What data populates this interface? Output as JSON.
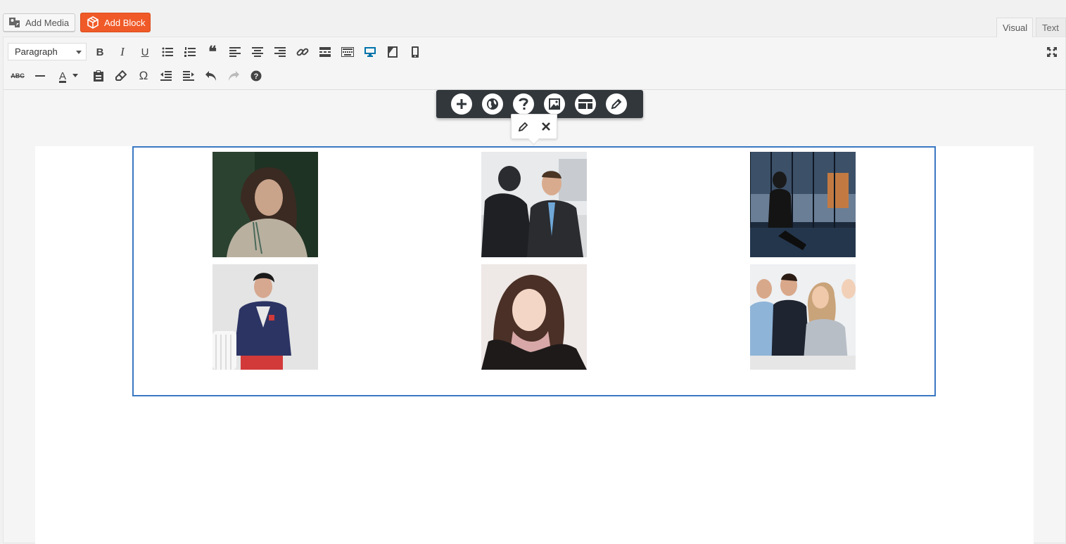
{
  "media_buttons": {
    "add_media_label": "Add Media",
    "add_block_label": "Add Block",
    "add_block_color": "#f05a28"
  },
  "editor_tabs": [
    {
      "label": "Visual",
      "active": true
    },
    {
      "label": "Text",
      "active": false
    }
  ],
  "toolbar": {
    "format_select": {
      "value": "Paragraph"
    },
    "row1_icons": [
      "bold-icon",
      "italic-icon",
      "underline-icon",
      "bullet-list-icon",
      "numbered-list-icon",
      "blockquote-icon",
      "align-left-icon",
      "align-center-icon",
      "align-right-icon",
      "link-icon",
      "read-more-icon",
      "toolbar-toggle-icon",
      "desktop-preview-icon",
      "tablet-preview-icon",
      "mobile-preview-icon",
      "fullscreen-icon"
    ],
    "row2_icons": [
      "strikethrough-icon",
      "horizontal-line-icon",
      "text-color-icon",
      "paste-as-text-icon",
      "clear-formatting-icon",
      "special-character-icon",
      "outdent-icon",
      "indent-icon",
      "undo-icon",
      "redo-icon",
      "help-icon"
    ],
    "glyphs": {
      "bold": "B",
      "italic": "I",
      "underline": "U",
      "quote": "❝",
      "omega": "Ω",
      "text_color": "A",
      "help": "?",
      "strike": "ABC"
    },
    "active_color": "#0073aa"
  },
  "floating_toolbar": {
    "icons": [
      "add-icon",
      "globe-icon",
      "help-icon",
      "image-icon",
      "layout-icon",
      "edit-pencil-icon"
    ]
  },
  "popover": {
    "icons": [
      "edit-pencil-icon",
      "close-icon"
    ]
  },
  "gallery": {
    "images": [
      {
        "name": "woman-dark-hair-photo",
        "colors": [
          "#1f3324",
          "#7a6a5a",
          "#b9b0a0"
        ]
      },
      {
        "name": "two-men-talking-photo",
        "colors": [
          "#e8eaec",
          "#2a2c30",
          "#6fa8d8"
        ]
      },
      {
        "name": "woman-window-silhouette-photo",
        "colors": [
          "#1c2a3c",
          "#6a7e96",
          "#c27a42"
        ]
      },
      {
        "name": "man-blue-jacket-photo",
        "colors": [
          "#e4e4e4",
          "#2c3464",
          "#d23a3a"
        ]
      },
      {
        "name": "smiling-woman-photo",
        "colors": [
          "#eee8e6",
          "#4a3026",
          "#f3d6c6"
        ]
      },
      {
        "name": "business-team-photo",
        "colors": [
          "#eef0f2",
          "#1e2430",
          "#c9a37a"
        ]
      }
    ],
    "selection_border_color": "#3a78c2"
  }
}
